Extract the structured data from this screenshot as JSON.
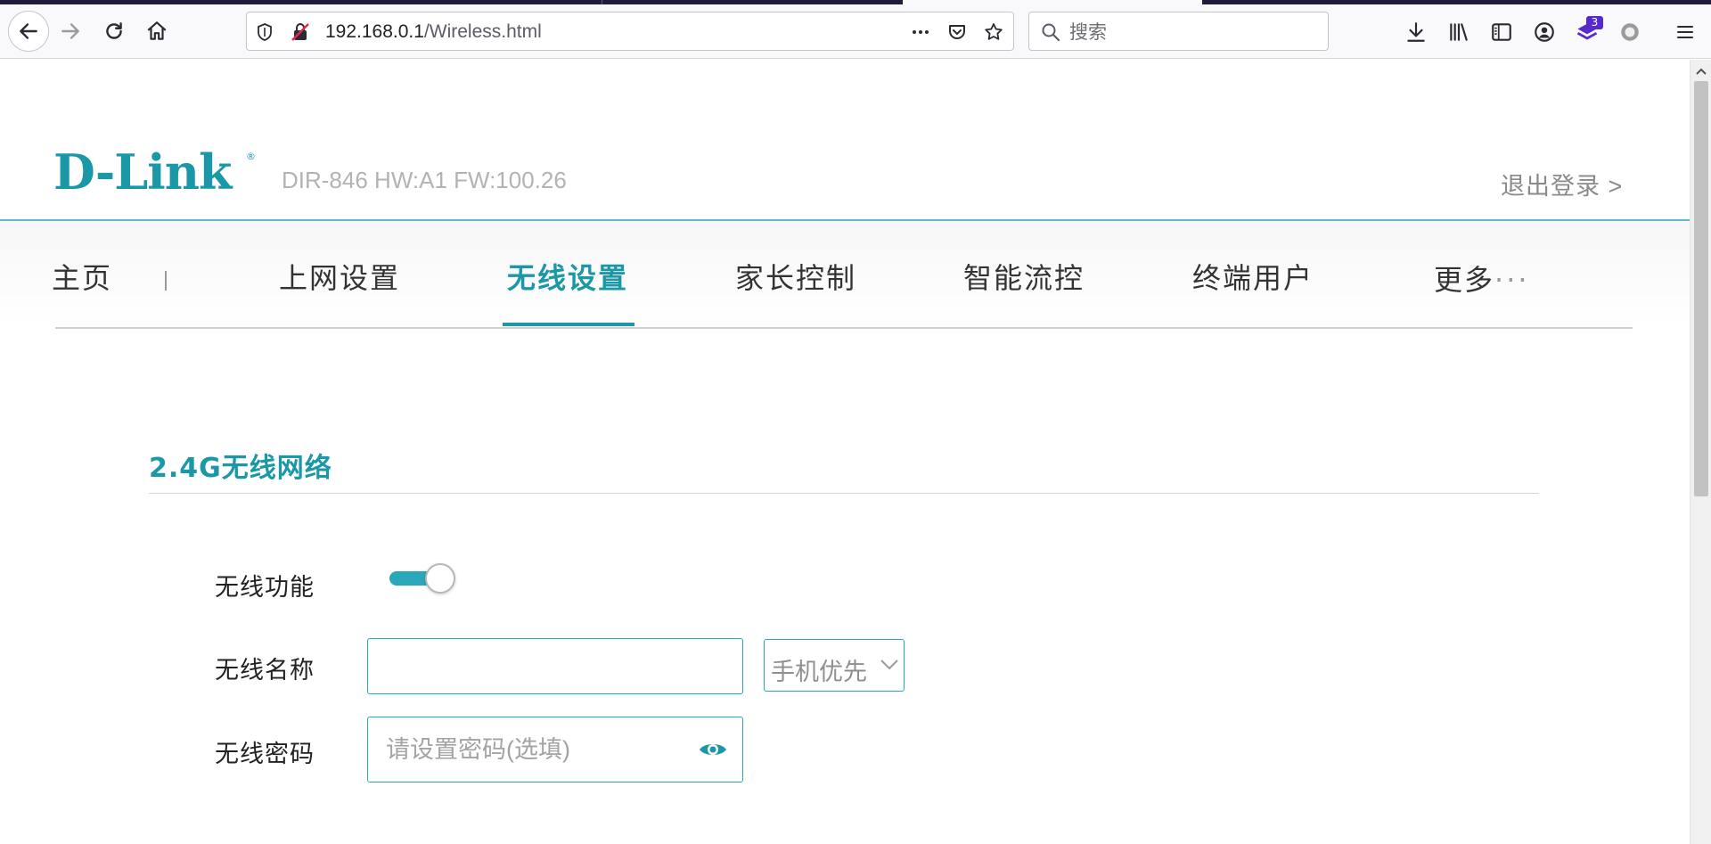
{
  "browser": {
    "url_host": "192.168.0.1",
    "url_path": "/Wireless.html",
    "search_placeholder": "搜索",
    "extension_badge": "3"
  },
  "header": {
    "logo": "D-Link",
    "logo_mark": "®",
    "model": "DIR-846 HW:A1 FW:100.26",
    "logout": "退出登录 >"
  },
  "nav": {
    "items": [
      {
        "label": "主页"
      },
      {
        "label": "上网设置"
      },
      {
        "label": "无线设置",
        "active": true
      },
      {
        "label": "家长控制"
      },
      {
        "label": "智能流控"
      },
      {
        "label": "终端用户"
      },
      {
        "label": "更多"
      }
    ],
    "more_dots": "···"
  },
  "section": {
    "title": "2.4G无线网络"
  },
  "form": {
    "wireless_enable_label": "无线功能",
    "wireless_enabled": true,
    "ssid_label": "无线名称",
    "ssid_value": "",
    "priority_selected": "手机优先",
    "password_label": "无线密码",
    "password_placeholder": "请设置密码(选填)"
  },
  "colors": {
    "brand": "#1b98a8",
    "toggle_on": "#2aa8ba"
  }
}
